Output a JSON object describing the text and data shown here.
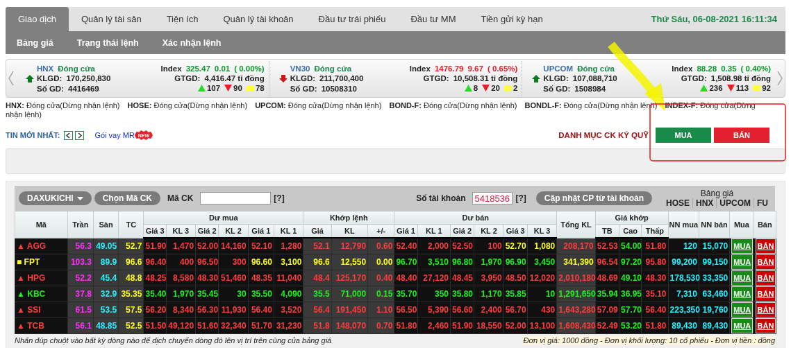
{
  "nav": {
    "tabs": [
      {
        "label": "Giao dịch",
        "selected": true
      },
      {
        "label": "Quản lý tài sản",
        "selected": false
      },
      {
        "label": "Tiện ích",
        "selected": false
      },
      {
        "label": "Quản lý tài khoản",
        "selected": false
      },
      {
        "label": "Đầu tư trái phiếu",
        "selected": false
      },
      {
        "label": "Đầu tư MM",
        "selected": false
      },
      {
        "label": "Tiền gửi kỳ hạn",
        "selected": false
      }
    ],
    "datetime": "Thứ Sáu, 06-08-2021 16:11:34"
  },
  "subnav": [
    "Bảng giá",
    "Trạng thái lệnh",
    "Xác nhận lệnh"
  ],
  "indices": [
    {
      "name": "HNX",
      "status": "Đóng cửa",
      "kind": "rising",
      "color": "#0a9a2a",
      "index_label": "Index",
      "index": "325.47",
      "change": "0.01",
      "percent": "( 0.00%)",
      "klgd_label": "KLGD:",
      "klgd": "170,250,830",
      "gtgd_label": "GTGD:",
      "gtgd": "4,416.47 tỉ đồng",
      "sogd_label": "Số GD:",
      "sogd": "4416469",
      "advances": "107",
      "declines": "90",
      "unchanged": "78"
    },
    {
      "name": "VN30",
      "status": "Đóng cửa",
      "kind": "falling",
      "color": "#ee1c25",
      "index_label": "Index",
      "index": "1476.79",
      "change": "9.67",
      "percent": "( 0.65%)",
      "klgd_label": "KLGD:",
      "klgd": "211,700,400",
      "gtgd_label": "GTGD:",
      "gtgd": "10,508.31 tỉ đồng",
      "sogd_label": "Số GD:",
      "sogd": "10508310",
      "advances": "8",
      "declines": "20",
      "unchanged": "2"
    },
    {
      "name": "UPCOM",
      "status": "Đóng cửa",
      "kind": "rising",
      "color": "#0a9a2a",
      "index_label": "Index",
      "index": "88.28",
      "change": "0.35",
      "percent": "( 0.40%)",
      "klgd_label": "KLGD:",
      "klgd": "107,088,710",
      "gtgd_label": "GTGD:",
      "gtgd": "1,508.98 tỉ đồng",
      "sogd_label": "Số GD:",
      "sogd": "1508984",
      "advances": "236",
      "declines": "113",
      "unchanged": "92"
    }
  ],
  "market_status": [
    {
      "market": "HNX:",
      "status": "Đóng cửa(Dừng nhận lệnh)"
    },
    {
      "market": "HOSE:",
      "status": "Đóng cửa(Dừng nhận lệnh)"
    },
    {
      "market": "UPCOM:",
      "status": "Đóng cửa(Dừng nhận lệnh)"
    },
    {
      "market": "BOND-F:",
      "status": "Đóng cửa(Dừng nhận lệnh)"
    },
    {
      "market": "BONDL-F:",
      "status": "Đóng cửa(Dừng nhận lệnh)"
    },
    {
      "market": "INDEX-F:",
      "status": "Đóng cửa(Dừng nhận lệnh)"
    }
  ],
  "news": {
    "label": "TIN MỚI NHẤT:",
    "link": "Gói vay MR",
    "badge": "NEW"
  },
  "margin_list": "DANH MỤC CK KÝ QUỸ",
  "buy_button": "MUA",
  "sell_button": "BÁN",
  "board": {
    "watchlist": "DAXUKICHI",
    "pick_button": "Chọn Mã CK",
    "symbol_label": "Mã CK",
    "symbol_help": "[?]",
    "account_label": "Số tài khoản",
    "account": "5418536",
    "account_help": "[?]",
    "update_button": "Cập nhật CP từ tài khoản",
    "board_label": "Bảng giá",
    "exchanges": [
      "HOSE",
      "HNX",
      "UPCOM",
      "FU"
    ],
    "header": [
      {
        "label": "Mã"
      },
      {
        "label": "Trần"
      },
      {
        "label": "Sàn"
      },
      {
        "label": "TC"
      },
      {
        "label": "Dư mua",
        "children": [
          "Giá 3",
          "KL 3",
          "Giá 2",
          "KL 2",
          "Giá 1",
          "KL 1"
        ]
      },
      {
        "label": "Khớp lệnh",
        "children": [
          "Giá",
          "KL",
          "+/-"
        ]
      },
      {
        "label": "Dư bán",
        "children": [
          "Giá 1",
          "KL 1",
          "Giá 2",
          "KL 2",
          "Giá 3",
          "KL 3"
        ]
      },
      {
        "label": "Tổng KL"
      },
      {
        "label": "Giá khớp",
        "children": [
          "TB",
          "Cao",
          "Thấp"
        ]
      },
      {
        "label": "NN mua"
      },
      {
        "label": "NN bán"
      },
      {
        "label": "Mua"
      },
      {
        "label": "Bán"
      }
    ],
    "rows": [
      {
        "marker": "▲",
        "symbol": "AGG",
        "color": "#ff3c3c",
        "buy": "MUA",
        "sell": "BÁN",
        "cells": [
          {
            "text": "56.3",
            "color": "#ff2eff"
          },
          {
            "text": "49.05",
            "color": "#26f0ff"
          },
          {
            "text": "52.7",
            "color": "#ffff1e"
          },
          {
            "text": "51.90",
            "color": "#ff3c3c"
          },
          {
            "text": "1,470",
            "color": "#ff3c3c"
          },
          {
            "text": "52.00",
            "color": "#ff3c3c"
          },
          {
            "text": "14,160",
            "color": "#ff3c3c"
          },
          {
            "text": "52.10",
            "color": "#ff3c3c"
          },
          {
            "text": "1,280",
            "color": "#ff3c3c"
          },
          {
            "text": "52.1",
            "color": "#ff3c3c"
          },
          {
            "text": "12,790",
            "color": "#ff3c3c"
          },
          {
            "text": "0.60",
            "color": "#ff3c3c"
          },
          {
            "text": "52.40",
            "color": "#ff3c3c"
          },
          {
            "text": "2,000",
            "color": "#ff3c3c"
          },
          {
            "text": "52.50",
            "color": "#ff3c3c"
          },
          {
            "text": "100",
            "color": "#ff3c3c"
          },
          {
            "text": "52.70",
            "color": "#ffff1e"
          },
          {
            "text": "1,080",
            "color": "#ffff1e"
          },
          {
            "text": "208,170",
            "color": "#ff3c3c"
          },
          {
            "text": "52.53",
            "color": "#ff3c3c"
          },
          {
            "text": "54.00",
            "color": "#1ef01e"
          },
          {
            "text": "51.80",
            "color": "#ff3c3c"
          },
          {
            "text": "120",
            "color": "#26f0ff"
          },
          {
            "text": "15,070",
            "color": "#26f0ff"
          }
        ]
      },
      {
        "marker": "■",
        "symbol": "FPT",
        "color": "#ffff1e",
        "buy": "MUA",
        "sell": "BÁN",
        "cells": [
          {
            "text": "103.3",
            "color": "#ff2eff"
          },
          {
            "text": "89.9",
            "color": "#26f0ff"
          },
          {
            "text": "96.6",
            "color": "#ffff1e"
          },
          {
            "text": "96.40",
            "color": "#ff3c3c"
          },
          {
            "text": "400",
            "color": "#ff3c3c"
          },
          {
            "text": "96.50",
            "color": "#ff3c3c"
          },
          {
            "text": "300",
            "color": "#ff3c3c"
          },
          {
            "text": "96.60",
            "color": "#ffff1e"
          },
          {
            "text": "3,100",
            "color": "#ffff1e"
          },
          {
            "text": "96.6",
            "color": "#ffff1e"
          },
          {
            "text": "12,550",
            "color": "#ffff1e"
          },
          {
            "text": "0.00",
            "color": "#ffff1e"
          },
          {
            "text": "96.70",
            "color": "#1ef01e"
          },
          {
            "text": "3,510",
            "color": "#1ef01e"
          },
          {
            "text": "96.80",
            "color": "#1ef01e"
          },
          {
            "text": "1,970",
            "color": "#1ef01e"
          },
          {
            "text": "96.90",
            "color": "#1ef01e"
          },
          {
            "text": "3,450",
            "color": "#1ef01e"
          },
          {
            "text": "341,390",
            "color": "#ffff1e"
          },
          {
            "text": "96.54",
            "color": "#ff3c3c"
          },
          {
            "text": "97.20",
            "color": "#1ef01e"
          },
          {
            "text": "95.80",
            "color": "#ff3c3c"
          },
          {
            "text": "99,200",
            "color": "#26f0ff"
          },
          {
            "text": "99,150",
            "color": "#26f0ff"
          }
        ]
      },
      {
        "marker": "▲",
        "symbol": "HPG",
        "color": "#ff3c3c",
        "buy": "MUA",
        "sell": "BÁN",
        "cells": [
          {
            "text": "52.2",
            "color": "#ff2eff"
          },
          {
            "text": "45.4",
            "color": "#26f0ff"
          },
          {
            "text": "48.8",
            "color": "#ffff1e"
          },
          {
            "text": "48.25",
            "color": "#ff3c3c"
          },
          {
            "text": "8,580",
            "color": "#ff3c3c"
          },
          {
            "text": "48.30",
            "color": "#ff3c3c"
          },
          {
            "text": "51,460",
            "color": "#ff3c3c"
          },
          {
            "text": "48.35",
            "color": "#ff3c3c"
          },
          {
            "text": "11,040",
            "color": "#ff3c3c"
          },
          {
            "text": "48.4",
            "color": "#ff3c3c"
          },
          {
            "text": "125,170",
            "color": "#ff3c3c"
          },
          {
            "text": "0.40",
            "color": "#ff3c3c"
          },
          {
            "text": "48.40",
            "color": "#ff3c3c"
          },
          {
            "text": "27,120",
            "color": "#ff3c3c"
          },
          {
            "text": "48.45",
            "color": "#ff3c3c"
          },
          {
            "text": "3,950",
            "color": "#ff3c3c"
          },
          {
            "text": "48.50",
            "color": "#ff3c3c"
          },
          {
            "text": "12,020",
            "color": "#ff3c3c"
          },
          {
            "text": "2,010,180",
            "color": "#ff3c3c"
          },
          {
            "text": "48.69",
            "color": "#ff3c3c"
          },
          {
            "text": "49.10",
            "color": "#1ef01e"
          },
          {
            "text": "48.30",
            "color": "#ff3c3c"
          },
          {
            "text": "178,530",
            "color": "#26f0ff"
          },
          {
            "text": "33,350",
            "color": "#26f0ff"
          }
        ]
      },
      {
        "marker": "▲",
        "symbol": "KBC",
        "color": "#1ef01e",
        "buy": "MUA",
        "sell": "BÁN",
        "cells": [
          {
            "text": "37.8",
            "color": "#ff2eff"
          },
          {
            "text": "32.9",
            "color": "#26f0ff"
          },
          {
            "text": "35.35",
            "color": "#ffff1e"
          },
          {
            "text": "35.40",
            "color": "#1ef01e"
          },
          {
            "text": "1,970",
            "color": "#1ef01e"
          },
          {
            "text": "35.45",
            "color": "#1ef01e"
          },
          {
            "text": "30",
            "color": "#1ef01e"
          },
          {
            "text": "35.50",
            "color": "#1ef01e"
          },
          {
            "text": "4,090",
            "color": "#1ef01e"
          },
          {
            "text": "35.5",
            "color": "#1ef01e"
          },
          {
            "text": "71,000",
            "color": "#1ef01e"
          },
          {
            "text": "0.15",
            "color": "#1ef01e"
          },
          {
            "text": "35.70",
            "color": "#1ef01e"
          },
          {
            "text": "350",
            "color": "#1ef01e"
          },
          {
            "text": "35.80",
            "color": "#1ef01e"
          },
          {
            "text": "1,170",
            "color": "#1ef01e"
          },
          {
            "text": "35.85",
            "color": "#1ef01e"
          },
          {
            "text": "10",
            "color": "#1ef01e"
          },
          {
            "text": "1,291,650",
            "color": "#1ef01e"
          },
          {
            "text": "35.94",
            "color": "#1ef01e"
          },
          {
            "text": "36.95",
            "color": "#1ef01e"
          },
          {
            "text": "35.10",
            "color": "#ff3c3c"
          },
          {
            "text": "7,310",
            "color": "#26f0ff"
          },
          {
            "text": "63,460",
            "color": "#26f0ff"
          }
        ]
      },
      {
        "marker": "▲",
        "symbol": "SSI",
        "color": "#ff3c3c",
        "buy": "MUA",
        "sell": "BÁN",
        "cells": [
          {
            "text": "61.5",
            "color": "#ff2eff"
          },
          {
            "text": "53.5",
            "color": "#26f0ff"
          },
          {
            "text": "57.5",
            "color": "#ffff1e"
          },
          {
            "text": "56.20",
            "color": "#ff3c3c"
          },
          {
            "text": "8,340",
            "color": "#ff3c3c"
          },
          {
            "text": "56.30",
            "color": "#ff3c3c"
          },
          {
            "text": "11,930",
            "color": "#ff3c3c"
          },
          {
            "text": "56.40",
            "color": "#ff3c3c"
          },
          {
            "text": "3,520",
            "color": "#ff3c3c"
          },
          {
            "text": "56.4",
            "color": "#ff3c3c"
          },
          {
            "text": "191,450",
            "color": "#ff3c3c"
          },
          {
            "text": "1.10",
            "color": "#ff3c3c"
          },
          {
            "text": "56.50",
            "color": "#ff3c3c"
          },
          {
            "text": "5,390",
            "color": "#ff3c3c"
          },
          {
            "text": "56.60",
            "color": "#ff3c3c"
          },
          {
            "text": "2,400",
            "color": "#ff3c3c"
          },
          {
            "text": "56.70",
            "color": "#ff3c3c"
          },
          {
            "text": "430",
            "color": "#ff3c3c"
          },
          {
            "text": "1,643,280",
            "color": "#ff3c3c"
          },
          {
            "text": "57.09",
            "color": "#ff3c3c"
          },
          {
            "text": "57.70",
            "color": "#1ef01e"
          },
          {
            "text": "56.40",
            "color": "#ff3c3c"
          },
          {
            "text": "223,350",
            "color": "#26f0ff"
          },
          {
            "text": "19,760",
            "color": "#26f0ff"
          }
        ]
      },
      {
        "marker": "▲",
        "symbol": "TCB",
        "color": "#ff3c3c",
        "buy": "MUA",
        "sell": "BÁN",
        "cells": [
          {
            "text": "56.1",
            "color": "#ff2eff"
          },
          {
            "text": "48.85",
            "color": "#26f0ff"
          },
          {
            "text": "52.5",
            "color": "#ffff1e"
          },
          {
            "text": "51.50",
            "color": "#ff3c3c"
          },
          {
            "text": "49,120",
            "color": "#ff3c3c"
          },
          {
            "text": "51.60",
            "color": "#ff3c3c"
          },
          {
            "text": "32,340",
            "color": "#ff3c3c"
          },
          {
            "text": "51.70",
            "color": "#ff3c3c"
          },
          {
            "text": "31,230",
            "color": "#ff3c3c"
          },
          {
            "text": "51.8",
            "color": "#ff3c3c"
          },
          {
            "text": "148,070",
            "color": "#ff3c3c"
          },
          {
            "text": "0.70",
            "color": "#ff3c3c"
          },
          {
            "text": "51.80",
            "color": "#ff3c3c"
          },
          {
            "text": "2,460",
            "color": "#ff3c3c"
          },
          {
            "text": "51.90",
            "color": "#ff3c3c"
          },
          {
            "text": "18,550",
            "color": "#ff3c3c"
          },
          {
            "text": "52.00",
            "color": "#ff3c3c"
          },
          {
            "text": "13,100",
            "color": "#ff3c3c"
          },
          {
            "text": "1,608,430",
            "color": "#ff3c3c"
          },
          {
            "text": "52.49",
            "color": "#ff3c3c"
          },
          {
            "text": "53.20",
            "color": "#1ef01e"
          },
          {
            "text": "51.80",
            "color": "#ff3c3c"
          },
          {
            "text": "89,430",
            "color": "#26f0ff"
          },
          {
            "text": "89,430",
            "color": "#26f0ff"
          }
        ]
      }
    ],
    "footnote": "Nhấn đúp chuột vào bất kỳ dòng nào để dịch chuyển dòng đó lên vị trí trên cùng của bảng giá",
    "units": "Đơn vị giá: 1000 đồng - Đơn vị khối lượng: 10 cổ phiếu - Đơn vị tiền : đồng"
  },
  "annotations": [
    {
      "kind": "arrow"
    },
    {
      "kind": "frame"
    }
  ]
}
